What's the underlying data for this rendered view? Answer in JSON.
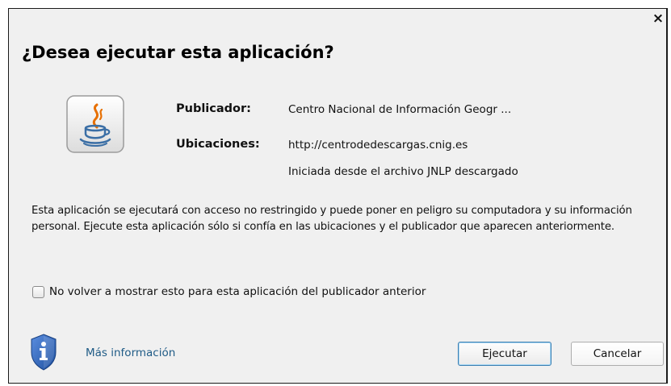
{
  "dialog": {
    "title": "¿Desea ejecutar esta aplicación?",
    "close_icon": "close-icon",
    "app_icon": "java-icon",
    "publisher_label": "Publicador:",
    "publisher_value": "Centro Nacional de Información Geogr ...",
    "locations_label": "Ubicaciones:",
    "location_url": "http://centrodedescargas.cnig.es",
    "location_note": "Iniciada desde el archivo JNLP descargado",
    "warning_text": "Esta aplicación se ejecutará con acceso no restringido y puede poner en peligro su computadora y su información personal. Ejecute esta aplicación sólo si confía en las ubicaciones y el publicador que aparecen anteriormente.",
    "checkbox_label": "No volver a mostrar esto para esta aplicación del publicador anterior",
    "checkbox_checked": false,
    "info_icon": "shield-info-icon",
    "more_info": "Más información",
    "run_button": "Ejecutar",
    "cancel_button": "Cancelar",
    "colors": {
      "background": "#f0f0f0",
      "link": "#1f5b86",
      "default_button_border": "#3c7fb1",
      "shield": "#2a5fb4"
    }
  }
}
